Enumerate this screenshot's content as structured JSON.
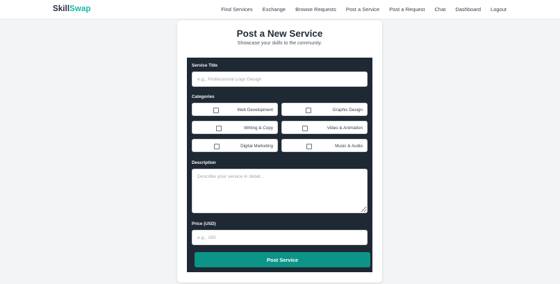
{
  "brand": {
    "part1": "Skill",
    "part2": "Swap"
  },
  "nav": {
    "items": [
      "Find Services",
      "Exchange",
      "Browse Requests",
      "Post a Service",
      "Post a Request",
      "Chat",
      "Dashboard",
      "Logout"
    ]
  },
  "card": {
    "title": "Post a New Service",
    "subtitle": "Showcase your skills to the community."
  },
  "form": {
    "service_title": {
      "label": "Service Title",
      "placeholder": "e.g., Professional Logo Design"
    },
    "categories": {
      "label": "Categories",
      "options": [
        "Web Development",
        "Graphic Design",
        "Writing & Copy",
        "Video & Animation",
        "Digital Marketing",
        "Music & Audio"
      ]
    },
    "description": {
      "label": "Description",
      "placeholder": "Describe your service in detail..."
    },
    "price": {
      "label": "Price (USD)",
      "placeholder": "e.g., 150"
    },
    "submit_label": "Post Service"
  },
  "colors": {
    "accent": "#0d9488",
    "brand_accent": "#14b8a6",
    "panel": "#1f2933",
    "background": "#f3f4f6"
  }
}
